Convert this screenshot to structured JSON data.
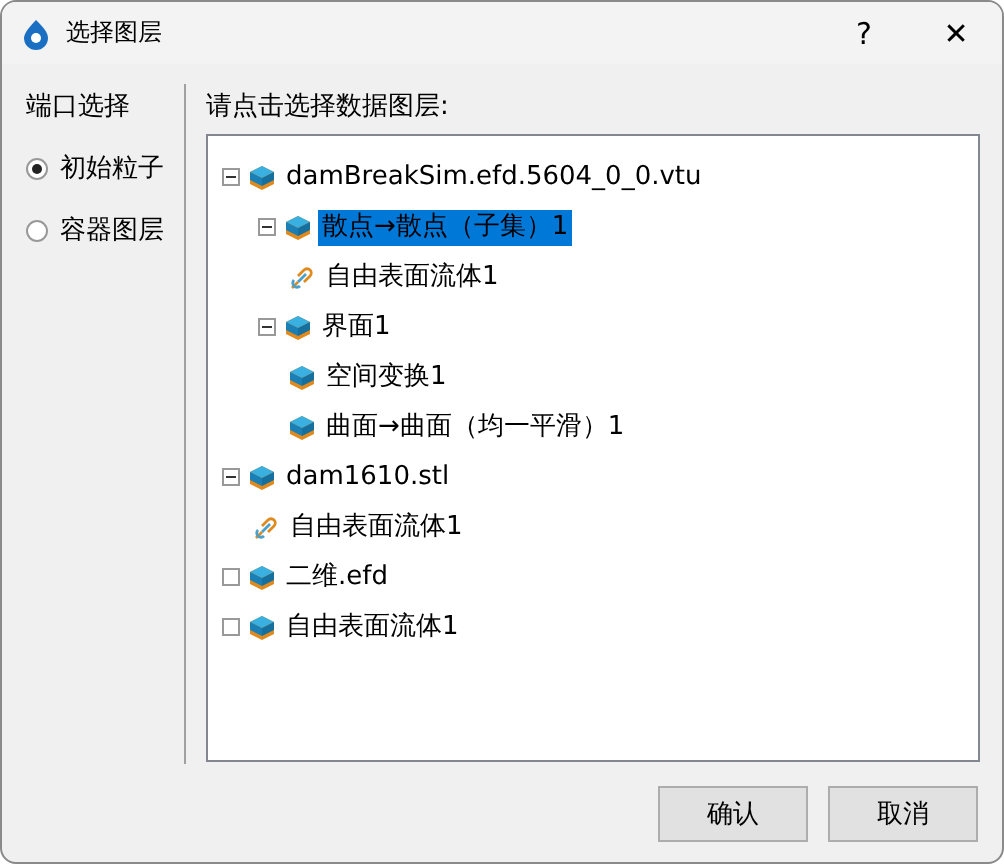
{
  "window": {
    "title": "选择图层",
    "buttons": [
      "?",
      "✕"
    ]
  },
  "port_panel": {
    "title": "端口选择",
    "options": [
      {
        "label": "初始粒子",
        "selected": true
      },
      {
        "label": "容器图层",
        "selected": false
      }
    ]
  },
  "layer_panel": {
    "prompt": "请点击选择数据图层:",
    "tree": [
      {
        "label": "damBreakSim.efd.5604_0_0.vtu",
        "kind": "layer",
        "expanded": true,
        "selected": false,
        "children": [
          {
            "label": "散点→散点（子集）1",
            "kind": "layer",
            "expanded": true,
            "selected": true,
            "children": [
              {
                "label": "自由表面流体1",
                "kind": "link",
                "selected": false
              }
            ]
          },
          {
            "label": "界面1",
            "kind": "layer",
            "expanded": true,
            "selected": false,
            "children": [
              {
                "label": "空间变换1",
                "kind": "layer",
                "selected": false
              },
              {
                "label": "曲面→曲面（均一平滑）1",
                "kind": "layer",
                "selected": false
              }
            ]
          }
        ]
      },
      {
        "label": "dam1610.stl",
        "kind": "layer",
        "expanded": true,
        "selected": false,
        "children": [
          {
            "label": "自由表面流体1",
            "kind": "link",
            "selected": false
          }
        ]
      },
      {
        "label": "二维.efd",
        "kind": "layer",
        "expanded": false,
        "selected": false
      },
      {
        "label": "自由表面流体1",
        "kind": "layer",
        "expanded": false,
        "selected": false
      }
    ]
  },
  "buttons": [
    "确认",
    "取消"
  ]
}
